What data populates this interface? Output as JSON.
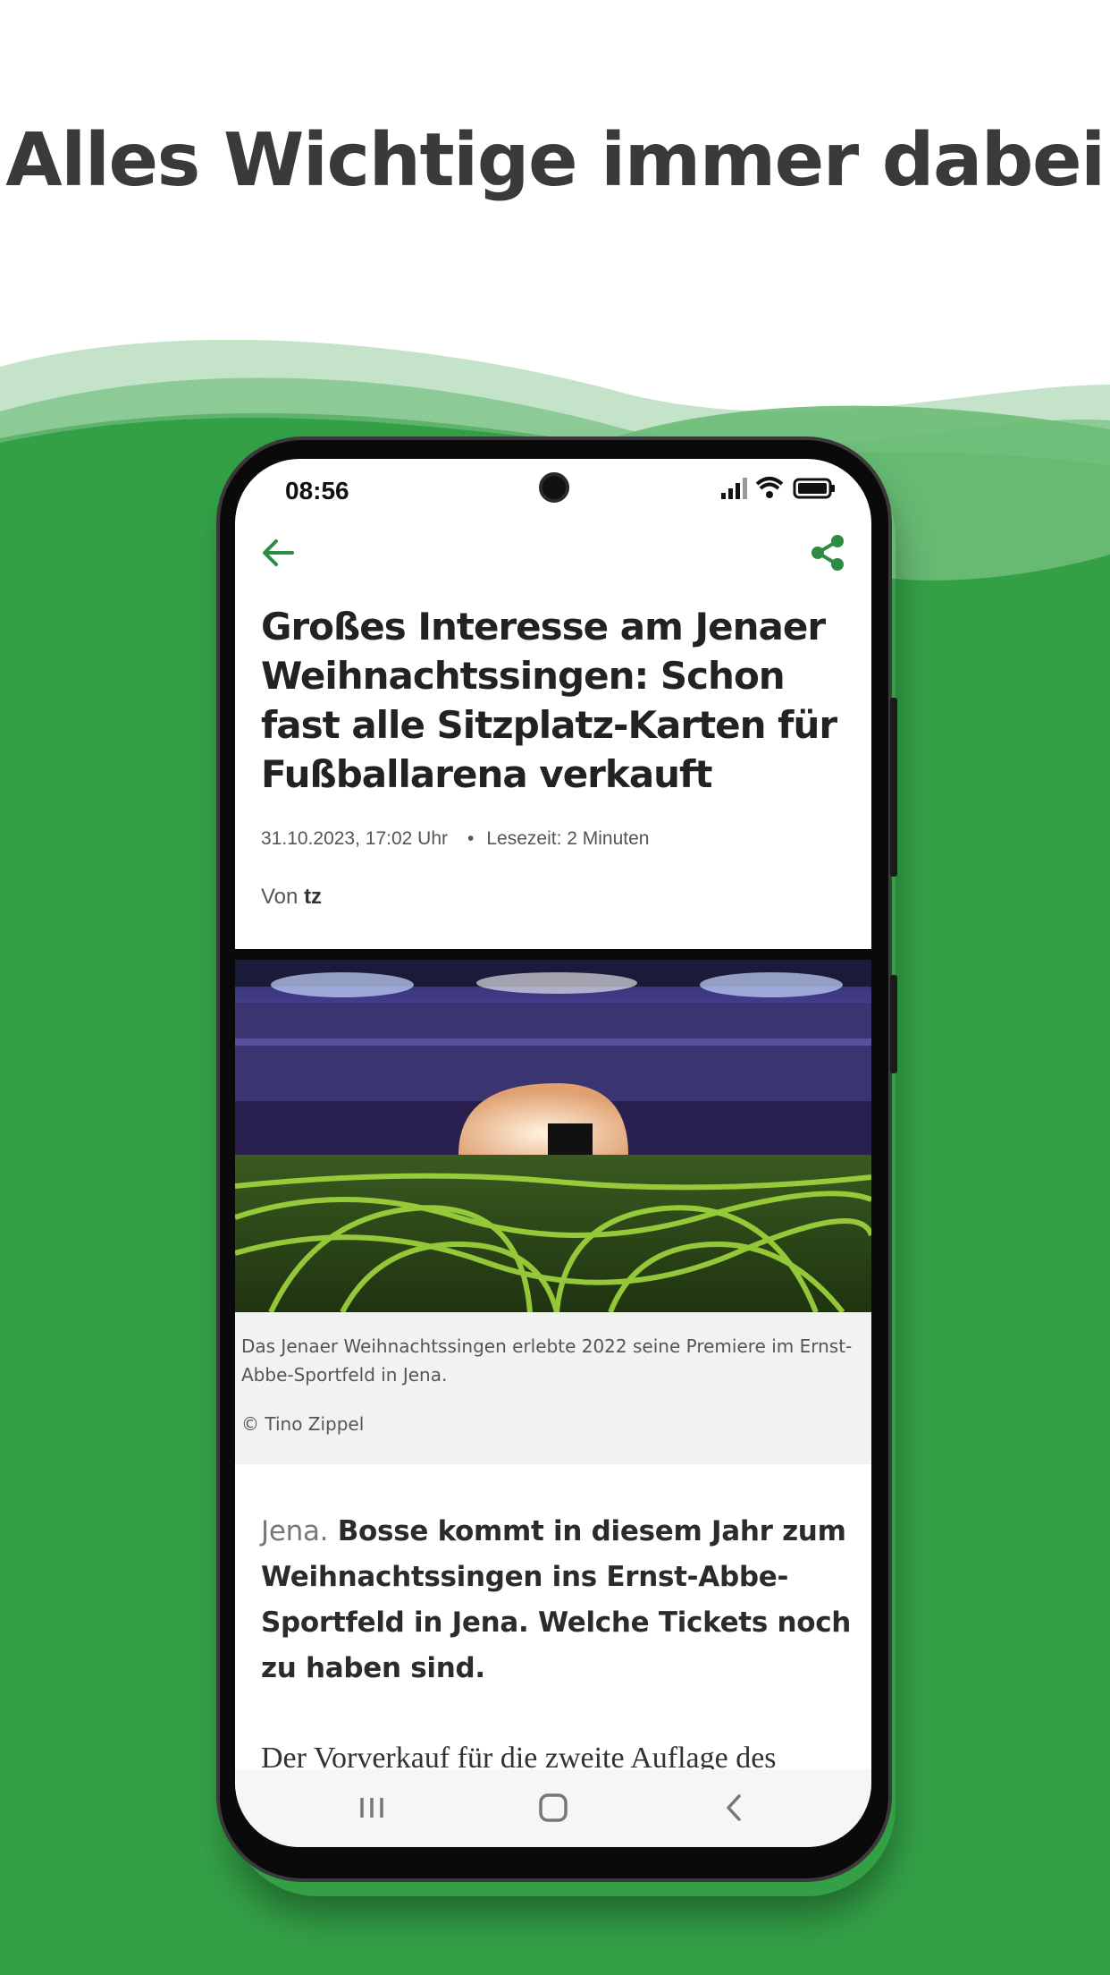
{
  "promo": {
    "headline": "Alles Wichtige immer dabei"
  },
  "colors": {
    "brand_green": "#33a046",
    "icon_green": "#2e8b44",
    "wave_light": "#a6d6ad"
  },
  "status_bar": {
    "time": "08:56",
    "icons": [
      "signal-icon",
      "wifi-icon",
      "battery-icon"
    ]
  },
  "app_bar": {
    "back_icon": "arrow-left-icon",
    "share_icon": "share-icon"
  },
  "article": {
    "title": "Großes Interesse am Jenaer Weihnachtssingen: Schon fast alle Sitzplatz-Karten für Fußballarena verkauft",
    "date": "31.10.2023, 17:02 Uhr",
    "separator": "•",
    "reading_time": "Lesezeit: 2 Minuten",
    "author_prefix": "Von",
    "author": "tz",
    "image_caption": "Das Jenaer Weihnachtssingen erlebte 2022 seine Premiere im Ernst-Abbe-Sportfeld in Jena.",
    "image_credit": "© Tino Zippel",
    "lead_place": "Jena.",
    "lead_text": "Bosse kommt in diesem Jahr zum Weihnachtssingen ins Ernst-Abbe-Sportfeld in Jena. Welche Tickets noch zu haben sind.",
    "body_start": "Der Vorverkauf für die zweite Auflage des"
  },
  "nav_bar": {
    "buttons": [
      "recent-apps-icon",
      "home-icon",
      "back-chevron-icon"
    ]
  }
}
